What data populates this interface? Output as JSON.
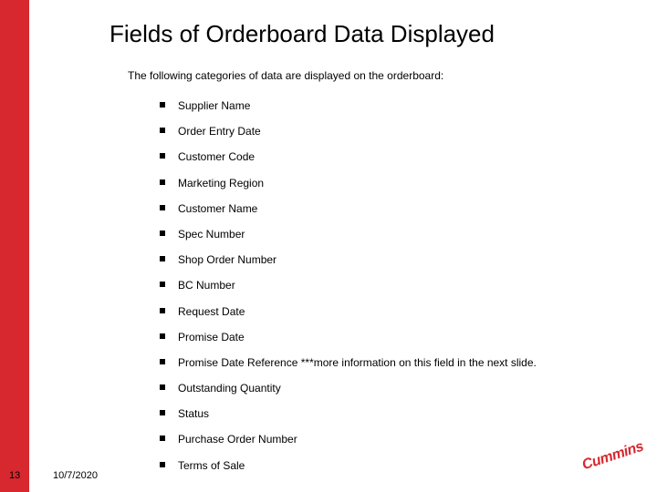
{
  "title": "Fields of Orderboard Data Displayed",
  "intro": "The following categories of data are displayed on the orderboard:",
  "bullets": [
    "Supplier Name",
    "Order Entry Date",
    "Customer Code",
    "Marketing Region",
    "Customer Name",
    "Spec Number",
    "Shop Order Number",
    "BC Number",
    "Request Date",
    "Promise Date",
    "Promise Date Reference ***more information on this field in the next slide.",
    "Outstanding Quantity",
    "Status",
    "Purchase Order Number",
    "Terms of Sale"
  ],
  "footer": {
    "slide_number": "13",
    "date": "10/7/2020"
  },
  "brand": {
    "name": "Cummins",
    "color": "#d7282f"
  }
}
